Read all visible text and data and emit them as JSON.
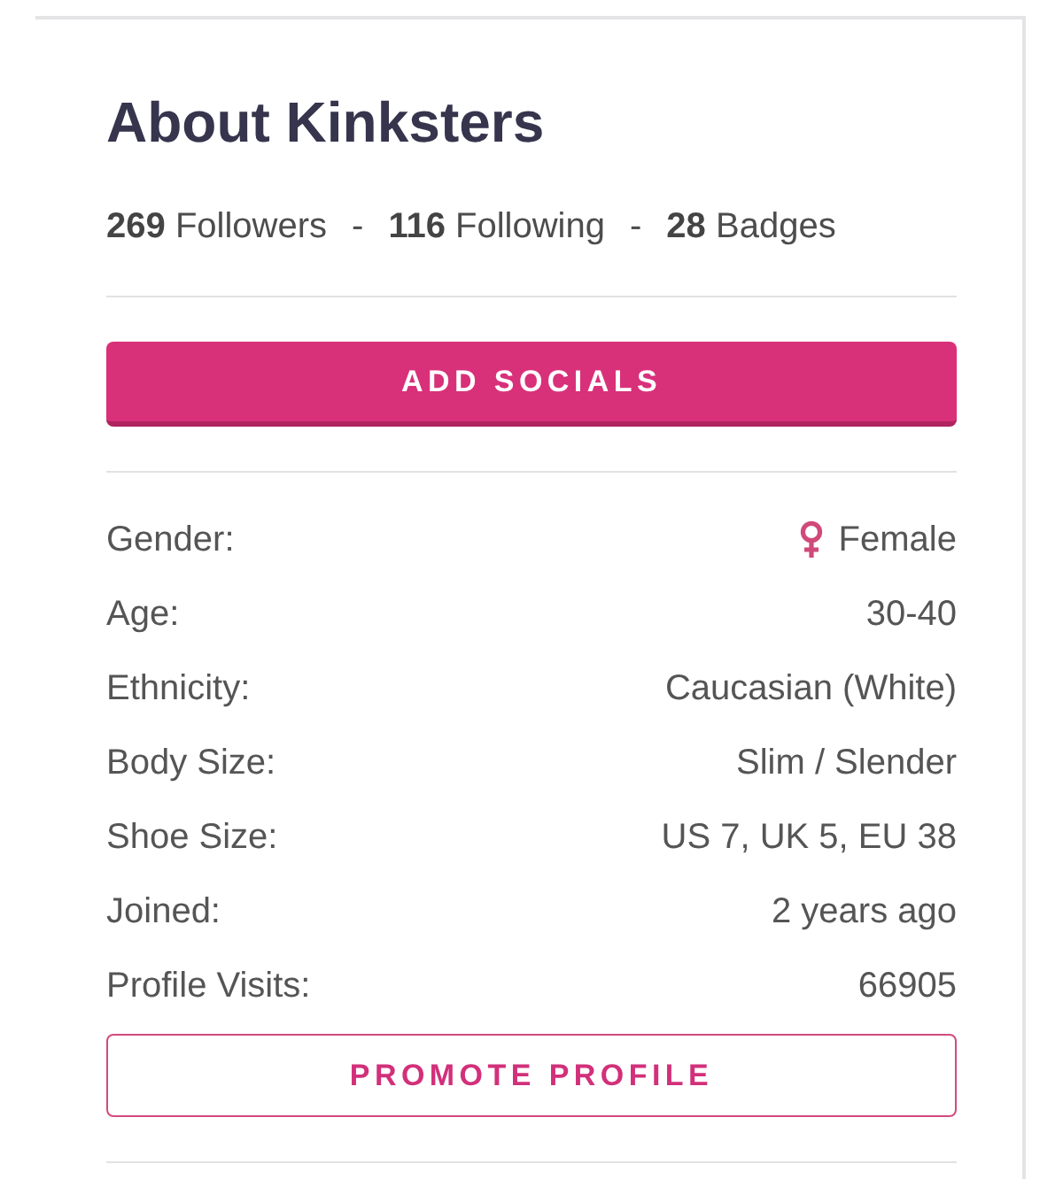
{
  "card": {
    "title": "About Kinksters",
    "stats": [
      {
        "kind": "stat",
        "count": "269",
        "label": "Followers"
      },
      {
        "kind": "separator",
        "text": "-"
      },
      {
        "kind": "stat",
        "count": "116",
        "label": "Following"
      },
      {
        "kind": "separator",
        "text": "-"
      },
      {
        "kind": "stat",
        "count": "28",
        "label": "Badges"
      }
    ],
    "add_socials_button": "ADD SOCIALS",
    "details": [
      {
        "kind": "symbol",
        "label": "Gender:",
        "value": "Female"
      },
      {
        "kind": "plain",
        "label": "Age:",
        "value": "30-40"
      },
      {
        "kind": "plain",
        "label": "Ethnicity:",
        "value": "Caucasian (White)"
      },
      {
        "kind": "plain",
        "label": "Body Size:",
        "value": "Slim / Slender"
      },
      {
        "kind": "plain",
        "label": "Shoe Size:",
        "value": "US 7, UK 5, EU 38"
      },
      {
        "kind": "plain",
        "label": "Joined:",
        "value": "2 years ago"
      },
      {
        "kind": "plain",
        "label": "Profile Visits:",
        "value": "66905"
      }
    ],
    "promote_button": "PROMOTE PROFILE"
  }
}
